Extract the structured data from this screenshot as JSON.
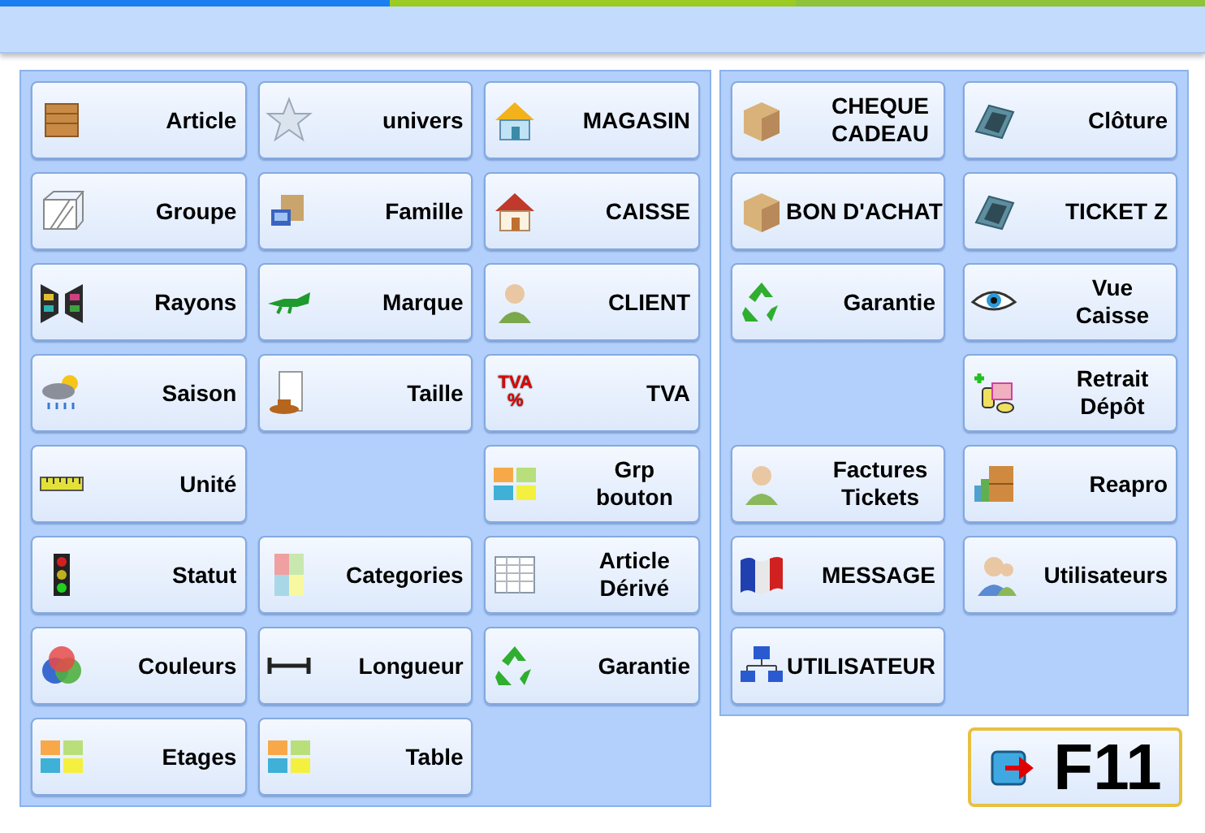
{
  "left_panel": {
    "rows": [
      [
        {
          "kind": "button",
          "lines": [
            "Article"
          ]
        },
        {
          "kind": "button",
          "lines": [
            "univers"
          ]
        },
        {
          "kind": "button",
          "lines": [
            "MAGASIN"
          ]
        }
      ],
      [
        {
          "kind": "button",
          "lines": [
            "Groupe"
          ]
        },
        {
          "kind": "button",
          "lines": [
            "Famille"
          ]
        },
        {
          "kind": "button",
          "lines": [
            "CAISSE"
          ]
        }
      ],
      [
        {
          "kind": "button",
          "lines": [
            "Rayons"
          ]
        },
        {
          "kind": "button",
          "lines": [
            "Marque"
          ]
        },
        {
          "kind": "button",
          "lines": [
            "CLIENT"
          ]
        }
      ],
      [
        {
          "kind": "button",
          "lines": [
            "Saison"
          ]
        },
        {
          "kind": "button",
          "lines": [
            "Taille"
          ]
        },
        {
          "kind": "button",
          "lines": [
            "TVA"
          ],
          "icon_text": [
            "TVA",
            "%"
          ]
        }
      ],
      [
        {
          "kind": "button",
          "lines": [
            "Unité"
          ]
        },
        {
          "kind": "empty"
        },
        {
          "kind": "button",
          "lines": [
            "Grp",
            "bouton"
          ]
        }
      ],
      [
        {
          "kind": "button",
          "lines": [
            "Statut"
          ]
        },
        {
          "kind": "button",
          "lines": [
            "Categories"
          ]
        },
        {
          "kind": "button",
          "lines": [
            "Article",
            "Dérivé"
          ]
        }
      ],
      [
        {
          "kind": "button",
          "lines": [
            "Couleurs"
          ]
        },
        {
          "kind": "button",
          "lines": [
            "Longueur"
          ]
        },
        {
          "kind": "button",
          "lines": [
            "Garantie"
          ]
        }
      ],
      [
        {
          "kind": "button",
          "lines": [
            "Etages"
          ]
        },
        {
          "kind": "button",
          "lines": [
            "Table"
          ]
        },
        {
          "kind": "empty"
        }
      ]
    ]
  },
  "right_panel": {
    "rows": [
      [
        {
          "kind": "button",
          "lines": [
            "CHEQUE",
            "CADEAU"
          ]
        },
        {
          "kind": "button",
          "lines": [
            "Clôture"
          ]
        }
      ],
      [
        {
          "kind": "button",
          "lines": [
            "BON D'ACHAT"
          ]
        },
        {
          "kind": "button",
          "lines": [
            "TICKET Z"
          ]
        }
      ],
      [
        {
          "kind": "button",
          "lines": [
            "Garantie"
          ]
        },
        {
          "kind": "button",
          "lines": [
            "Vue",
            "Caisse"
          ]
        }
      ],
      [
        {
          "kind": "empty"
        },
        {
          "kind": "button",
          "lines": [
            "Retrait",
            "Dépôt"
          ]
        }
      ],
      [
        {
          "kind": "button",
          "lines": [
            "Factures",
            "Tickets"
          ]
        },
        {
          "kind": "button",
          "lines": [
            "Reapro"
          ]
        }
      ],
      [
        {
          "kind": "button",
          "lines": [
            "MESSAGE"
          ]
        },
        {
          "kind": "button",
          "lines": [
            "Utilisateurs"
          ]
        }
      ],
      [
        {
          "kind": "button",
          "lines": [
            "UTILISATEUR"
          ]
        },
        {
          "kind": "empty"
        }
      ]
    ]
  },
  "exit_button": {
    "label": "F11"
  }
}
